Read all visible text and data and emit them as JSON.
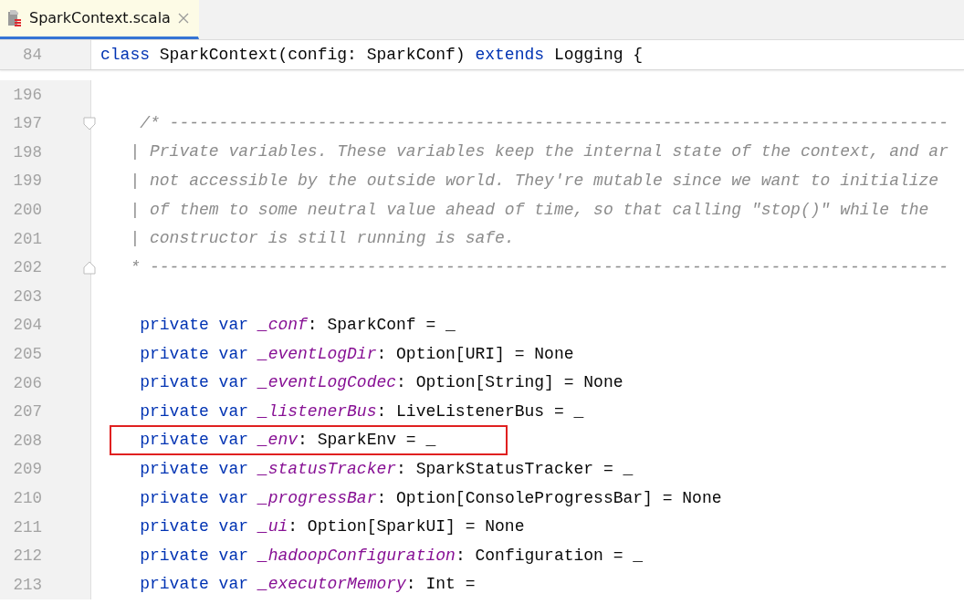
{
  "tabs": [
    {
      "label": "SparkContext.scala",
      "selected": true
    }
  ],
  "sticky_line": {
    "number": "84",
    "tokens": [
      {
        "kind": "keyword",
        "text": "class "
      },
      {
        "kind": "plain",
        "text": "SparkContext(config: SparkConf) "
      },
      {
        "kind": "keyword",
        "text": "extends "
      },
      {
        "kind": "plain",
        "text": "Logging {"
      }
    ]
  },
  "lines": [
    {
      "number": "196",
      "highlighted": false
    },
    {
      "number": "197",
      "highlighted": false,
      "fold_start": true,
      "tokens": [
        {
          "kind": "comment",
          "text": "    /* -------------------------------------------------------------------------------"
        }
      ]
    },
    {
      "number": "198",
      "highlighted": false,
      "tokens": [
        {
          "kind": "comment",
          "text": "   | Private variables. These variables keep the internal state of the context, and ar"
        }
      ]
    },
    {
      "number": "199",
      "highlighted": false,
      "tokens": [
        {
          "kind": "comment",
          "text": "   | not accessible by the outside world. They're mutable since we want to initialize"
        }
      ]
    },
    {
      "number": "200",
      "highlighted": false,
      "tokens": [
        {
          "kind": "comment",
          "text": "   | of them to some neutral value ahead of time, so that calling \"stop()\" while the"
        }
      ]
    },
    {
      "number": "201",
      "highlighted": false,
      "tokens": [
        {
          "kind": "comment",
          "text": "   | constructor is still running is safe."
        }
      ]
    },
    {
      "number": "202",
      "highlighted": false,
      "fold_end": true,
      "tokens": [
        {
          "kind": "comment",
          "text": "   * ---------------------------------------------------------------------------------"
        }
      ]
    },
    {
      "number": "203",
      "highlighted": false
    },
    {
      "number": "204",
      "highlighted": false,
      "tokens": [
        {
          "kind": "keyword",
          "text": "    private var "
        },
        {
          "kind": "field",
          "text": "_conf"
        },
        {
          "kind": "plain",
          "text": ": SparkConf = _"
        }
      ]
    },
    {
      "number": "205",
      "highlighted": false,
      "tokens": [
        {
          "kind": "keyword",
          "text": "    private var "
        },
        {
          "kind": "field",
          "text": "_eventLogDir"
        },
        {
          "kind": "plain",
          "text": ": Option[URI] = None"
        }
      ]
    },
    {
      "number": "206",
      "highlighted": false,
      "tokens": [
        {
          "kind": "keyword",
          "text": "    private var "
        },
        {
          "kind": "field",
          "text": "_eventLogCodec"
        },
        {
          "kind": "plain",
          "text": ": Option[String] = None"
        }
      ]
    },
    {
      "number": "207",
      "highlighted": false,
      "tokens": [
        {
          "kind": "keyword",
          "text": "    private var "
        },
        {
          "kind": "field",
          "text": "_listenerBus"
        },
        {
          "kind": "plain",
          "text": ": LiveListenerBus = _"
        }
      ]
    },
    {
      "number": "208",
      "highlighted": true,
      "tokens": [
        {
          "kind": "keyword",
          "text": "    private var "
        },
        {
          "kind": "field",
          "text": "_env"
        },
        {
          "kind": "plain",
          "text": ": SparkEnv = _"
        }
      ]
    },
    {
      "number": "209",
      "highlighted": false,
      "tokens": [
        {
          "kind": "keyword",
          "text": "    private var "
        },
        {
          "kind": "field",
          "text": "_statusTracker"
        },
        {
          "kind": "plain",
          "text": ": SparkStatusTracker = _"
        }
      ]
    },
    {
      "number": "210",
      "highlighted": false,
      "tokens": [
        {
          "kind": "keyword",
          "text": "    private var "
        },
        {
          "kind": "field",
          "text": "_progressBar"
        },
        {
          "kind": "plain",
          "text": ": Option[ConsoleProgressBar] = None"
        }
      ]
    },
    {
      "number": "211",
      "highlighted": false,
      "tokens": [
        {
          "kind": "keyword",
          "text": "    private var "
        },
        {
          "kind": "field",
          "text": "_ui"
        },
        {
          "kind": "plain",
          "text": ": Option[SparkUI] = None"
        }
      ]
    },
    {
      "number": "212",
      "highlighted": false,
      "tokens": [
        {
          "kind": "keyword",
          "text": "    private var "
        },
        {
          "kind": "field",
          "text": "_hadoopConfiguration"
        },
        {
          "kind": "plain",
          "text": ": Configuration = _"
        }
      ]
    },
    {
      "number": "213",
      "highlighted": false,
      "tokens": [
        {
          "kind": "keyword",
          "text": "    private var "
        },
        {
          "kind": "field",
          "text": "_executorMemory"
        },
        {
          "kind": "plain",
          "text": ": Int ="
        }
      ]
    }
  ]
}
